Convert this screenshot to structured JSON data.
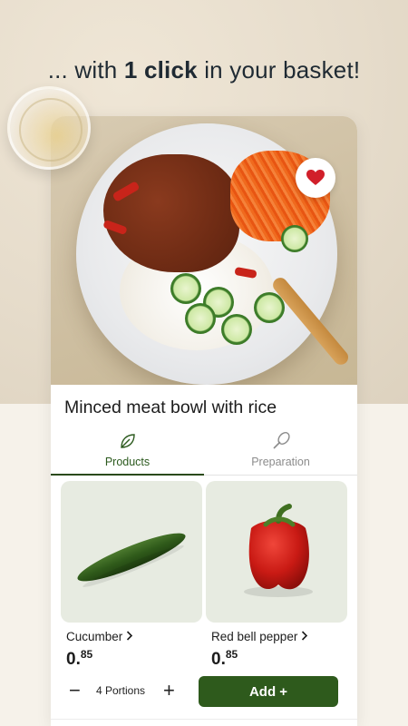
{
  "headline": {
    "prefix": "... with ",
    "emphasis": "1 click",
    "suffix": " in your basket!"
  },
  "hero": {
    "favorite_icon": "heart-icon",
    "favorite_color": "#d11f2a"
  },
  "recipe": {
    "title": "Minced meat bowl with rice"
  },
  "tabs": [
    {
      "label": "Products",
      "icon": "leaf-icon",
      "active": true
    },
    {
      "label": "Preparation",
      "icon": "whisk-icon",
      "active": false
    }
  ],
  "products": [
    {
      "name": "Cucumber",
      "price_main": "0.",
      "price_cents": "85"
    },
    {
      "name": "Red bell pepper",
      "price_main": "0.",
      "price_cents": "85"
    }
  ],
  "stepper": {
    "minus": "−",
    "portions": "4 Portions",
    "plus": "+"
  },
  "add_button": {
    "label": "Add +"
  },
  "colors": {
    "accent": "#2e5a1c",
    "tab_active": "#2c5a1e",
    "tab_inactive": "#8c8c8c"
  }
}
